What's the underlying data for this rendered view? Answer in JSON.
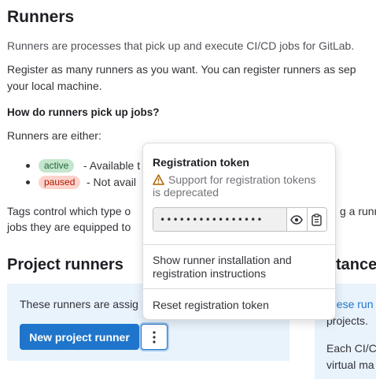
{
  "header": {
    "title": "Runners",
    "intro": "Runners are processes that pick up and execute CI/CD jobs for GitLab.",
    "register_line1": "Register as many runners as you want. You can register runners as sep",
    "register_line2": "your local machine."
  },
  "pickup": {
    "heading": "How do runners pick up jobs?",
    "either": "Runners are either:",
    "items": [
      {
        "badge": "active",
        "text": "- Available t"
      },
      {
        "badge": "paused",
        "text": "- Not avail"
      }
    ],
    "tags_line1": "Tags control which type o",
    "tags_line1_right": "g a runn",
    "tags_line2": "jobs they are equipped to"
  },
  "project_runners": {
    "title": "Project runners",
    "assigned_text": "These runners are assig",
    "new_button": "New project runner"
  },
  "instance_runners": {
    "title_partial": "tance",
    "link_text": "hese run",
    "line2": "projects.",
    "line3": "Each CI/C",
    "line4": "virtual ma"
  },
  "dropdown": {
    "token_title": "Registration token",
    "deprecation_warning": "Support for registration tokens is deprecated",
    "token_masked": "••••••••••••••••",
    "show_instructions": "Show runner installation and registration instructions",
    "reset_token": "Reset registration token"
  },
  "colors": {
    "primary": "#1f75cb",
    "panel": "#e9f3fc",
    "warning": "#ab6100",
    "badge_active_bg": "#c3e6cd",
    "badge_paused_bg": "#fdd4cd"
  },
  "icons": [
    "warning-icon",
    "eye-icon",
    "clipboard-icon",
    "ellipsis-v-icon"
  ]
}
